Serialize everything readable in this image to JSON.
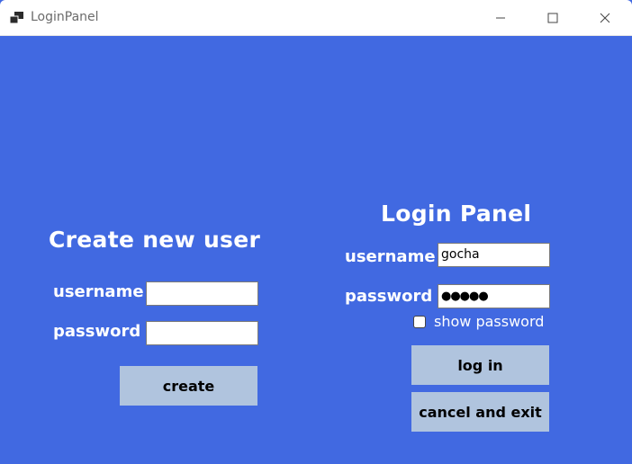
{
  "window": {
    "title": "LoginPanel",
    "icons": {
      "app": "app-window-icon",
      "minimize": "minimize-icon",
      "maximize": "maximize-icon",
      "close": "close-icon"
    }
  },
  "create_user": {
    "heading": "Create new user",
    "username_label": "username",
    "username_value": "",
    "password_label": "password",
    "password_value": "",
    "create_button": "create"
  },
  "login": {
    "heading": "Login Panel",
    "username_label": "username",
    "username_value": "gocha",
    "password_label": "password",
    "password_value": "●●●●●",
    "show_password_label": "show password",
    "show_password_checked": false,
    "login_button": "log in",
    "cancel_button": "cancel and exit"
  },
  "colors": {
    "background": "#4169e1",
    "button": "#b0c4de",
    "text": "#ffffff"
  }
}
